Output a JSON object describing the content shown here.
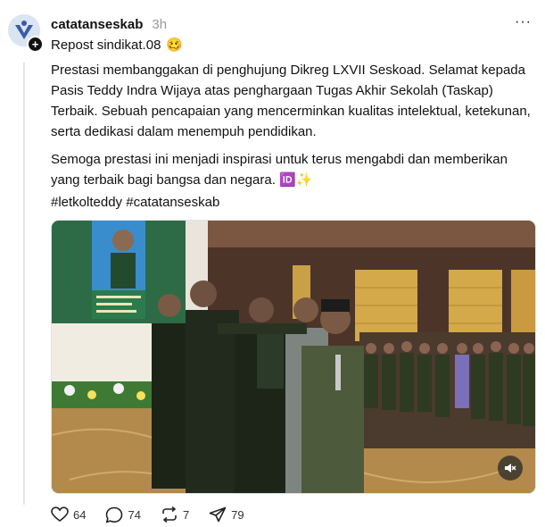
{
  "post": {
    "username": "catatanseskab",
    "time": "3h",
    "repost": "Repost sindikat.08",
    "repost_emoji": "🥴",
    "paragraph1": "Prestasi membanggakan di penghujung Dikreg LXVII Seskoad. Selamat kepada Pasis Teddy Indra Wijaya atas penghargaan Tugas Akhir Sekolah (Taskap) Terbaik. Sebuah pencapaian yang mencerminkan kualitas intelektual, ketekunan, serta dedikasi dalam menempuh pendidikan.",
    "paragraph2": "Semoga prestasi ini menjadi inspirasi untuk terus mengabdi dan memberikan yang terbaik bagi bangsa dan negara. 🆔✨",
    "hashtags": "#letkolteddy #catatanseskab",
    "more": "···"
  },
  "actions": {
    "likes": "64",
    "replies": "74",
    "reposts": "7",
    "shares": "79"
  },
  "icons": [
    "plus-icon",
    "more-icon",
    "mute-icon",
    "heart-icon",
    "comment-icon",
    "repost-icon",
    "share-icon"
  ]
}
